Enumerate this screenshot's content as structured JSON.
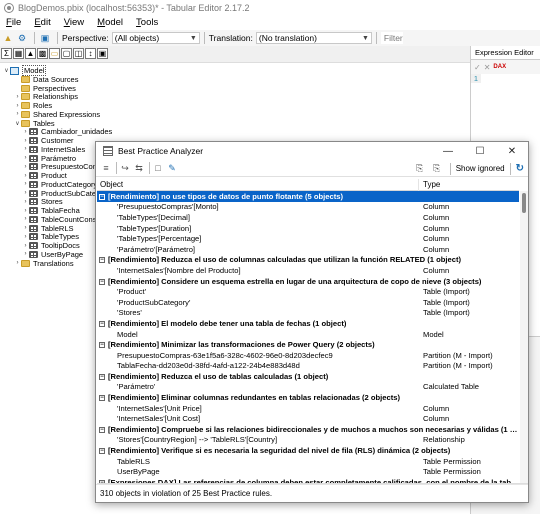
{
  "window": {
    "title": "BlogDemos.pbix (localhost:56353)* - Tabular Editor 2.17.2"
  },
  "menu": [
    "File",
    "Edit",
    "View",
    "Model",
    "Tools"
  ],
  "toolbar": {
    "perspective_label": "Perspective:",
    "perspective_value": "(All objects)",
    "translation_label": "Translation:",
    "translation_value": "(No translation)",
    "filter_placeholder": "Filter"
  },
  "tree": {
    "root": "Model",
    "items": [
      {
        "label": "Data Sources",
        "type": "folder",
        "level": 1,
        "exp": ""
      },
      {
        "label": "Perspectives",
        "type": "folder",
        "level": 1,
        "exp": ""
      },
      {
        "label": "Relationships",
        "type": "folder",
        "level": 1,
        "exp": ">"
      },
      {
        "label": "Roles",
        "type": "folder",
        "level": 1,
        "exp": ">"
      },
      {
        "label": "Shared Expressions",
        "type": "folder",
        "level": 1,
        "exp": ">"
      },
      {
        "label": "Tables",
        "type": "folder",
        "level": 1,
        "exp": "v"
      },
      {
        "label": "Cambiador_unidades",
        "type": "table",
        "level": 2,
        "exp": ">"
      },
      {
        "label": "Customer",
        "type": "table",
        "level": 2,
        "exp": ">"
      },
      {
        "label": "InternetSales",
        "type": "table",
        "level": 2,
        "exp": ">"
      },
      {
        "label": "Parámetro",
        "type": "table",
        "level": 2,
        "exp": ">"
      },
      {
        "label": "PresupuestoCompras",
        "type": "table",
        "level": 2,
        "exp": ">"
      },
      {
        "label": "Product",
        "type": "table",
        "level": 2,
        "exp": ">"
      },
      {
        "label": "ProductCategory",
        "type": "table",
        "level": 2,
        "exp": ">"
      },
      {
        "label": "ProductSubCategory",
        "type": "table",
        "level": 2,
        "exp": ">"
      },
      {
        "label": "Stores",
        "type": "table",
        "level": 2,
        "exp": ">"
      },
      {
        "label": "TablaFecha",
        "type": "table",
        "level": 2,
        "exp": ">"
      },
      {
        "label": "TableCountConsecutive",
        "type": "table",
        "level": 2,
        "exp": ">"
      },
      {
        "label": "TableRLS",
        "type": "table",
        "level": 2,
        "exp": ">"
      },
      {
        "label": "TableTypes",
        "type": "table",
        "level": 2,
        "exp": ">"
      },
      {
        "label": "TooltipDocs",
        "type": "table",
        "level": 2,
        "exp": ">"
      },
      {
        "label": "UserByPage",
        "type": "table",
        "level": 2,
        "exp": ">"
      },
      {
        "label": "Translations",
        "type": "folder",
        "level": 1,
        "exp": ">"
      }
    ]
  },
  "expression_editor": {
    "tab": "Expression Editor",
    "line_number": "1"
  },
  "bpa": {
    "title": "Best Practice Analyzer",
    "show_ignored": "Show ignored",
    "col_object": "Object",
    "col_type": "Type",
    "rows": [
      {
        "kind": "rule",
        "object": "[Rendimiento] no use tipos de datos de punto flotante (5 objects)",
        "type": "",
        "selected": true
      },
      {
        "kind": "obj",
        "object": "'PresupuestoCompras'[Monto]",
        "type": "Column"
      },
      {
        "kind": "obj",
        "object": "'TableTypes'[Decimal]",
        "type": "Column"
      },
      {
        "kind": "obj",
        "object": "'TableTypes'[Duration]",
        "type": "Column"
      },
      {
        "kind": "obj",
        "object": "'TableTypes'[Percentage]",
        "type": "Column"
      },
      {
        "kind": "obj",
        "object": "'Parámetro'[Parámetro]",
        "type": "Column"
      },
      {
        "kind": "rule",
        "object": "[Rendimiento] Reduzca el uso de columnas calculadas que utilizan la función RELATED (1 object)",
        "type": ""
      },
      {
        "kind": "obj",
        "object": "'InternetSales'[Nombre del Producto]",
        "type": "Column"
      },
      {
        "kind": "rule",
        "object": "[Rendimiento] Considere un esquema estrella en lugar de una arquitectura de copo de nieve (3 objects)",
        "type": ""
      },
      {
        "kind": "obj",
        "object": "'Product'",
        "type": "Table (Import)"
      },
      {
        "kind": "obj",
        "object": "'ProductSubCategory'",
        "type": "Table (Import)"
      },
      {
        "kind": "obj",
        "object": "'Stores'",
        "type": "Table (Import)"
      },
      {
        "kind": "rule",
        "object": "[Rendimiento] El modelo debe tener una tabla de fechas (1 object)",
        "type": ""
      },
      {
        "kind": "obj",
        "object": "Model",
        "type": "Model"
      },
      {
        "kind": "rule",
        "object": "[Rendimiento] Minimizar las transformaciones de Power Query (2 objects)",
        "type": ""
      },
      {
        "kind": "obj",
        "object": "PresupuestoCompras-63e1f5a6-328c-4602-96e0-8d203decfec9",
        "type": "Partition (M - Import)"
      },
      {
        "kind": "obj",
        "object": "TablaFecha-dd203e0d-38fd-4afd-a122-24b4e883d48d",
        "type": "Partition (M - Import)"
      },
      {
        "kind": "rule",
        "object": "[Rendimiento] Reduzca el uso de tablas calculadas (1 object)",
        "type": ""
      },
      {
        "kind": "obj",
        "object": "'Parámetro'",
        "type": "Calculated Table"
      },
      {
        "kind": "rule",
        "object": "[Rendimiento] Eliminar columnas redundantes en tablas relacionadas (2 objects)",
        "type": ""
      },
      {
        "kind": "obj",
        "object": "'InternetSales'[Unit Price]",
        "type": "Column"
      },
      {
        "kind": "obj",
        "object": "'InternetSales'[Unit Cost]",
        "type": "Column"
      },
      {
        "kind": "rule",
        "object": "[Rendimiento] Compruebe si las relaciones bidireccionales y de muchos a muchos son necesarias y válidas (1 obj...",
        "type": ""
      },
      {
        "kind": "obj",
        "object": "'Stores'[CountryRegion] --> 'TableRLS'[Country]",
        "type": "Relationship"
      },
      {
        "kind": "rule",
        "object": "[Rendimiento] Verifique si es necesaria la seguridad del nivel de fila (RLS) dinámica (2 objects)",
        "type": ""
      },
      {
        "kind": "obj",
        "object": "TableRLS",
        "type": "Table Permission"
      },
      {
        "kind": "obj",
        "object": "UserByPage",
        "type": "Table Permission"
      },
      {
        "kind": "rule",
        "object": "[Expresiones DAX] Las referencias de columna deben estar completamente calificadas, con el nombre de la tabl...",
        "type": ""
      }
    ],
    "status": "310 objects in violation of 25 Best Practice rules."
  }
}
